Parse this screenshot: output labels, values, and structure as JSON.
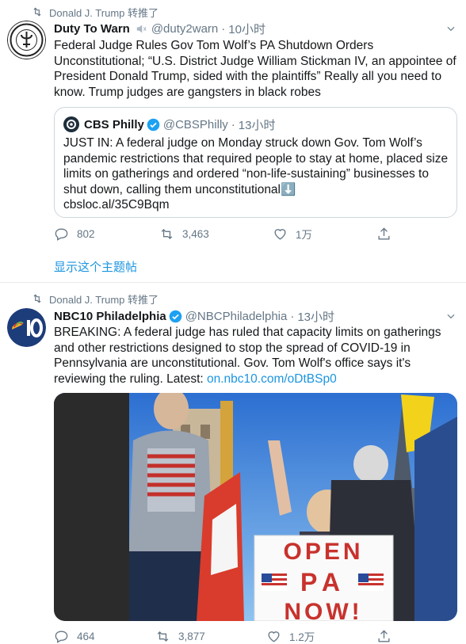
{
  "tweets": [
    {
      "retweeted_by": "Donald J. Trump 转推了",
      "author": {
        "name": "Duty To Warn",
        "handle": "@duty2warn",
        "time": "10小时"
      },
      "text": "Federal Judge Rules Gov Tom Wolf’s PA Shutdown Orders Unconstitutional; “U.S. District Judge William Stickman IV, an appointee of President Donald Trump, sided with the plaintiffs” Really all you need to know. Trump judges are gangsters in black robes",
      "quote": {
        "author": {
          "name": "CBS Philly",
          "handle": "@CBSPhilly",
          "time": "13小时"
        },
        "text": "JUST IN: A federal judge on Monday struck down Gov. Tom Wolf’s pandemic restrictions that required people to stay at home, placed size limits on gatherings and ordered “non-life-sustaining” businesses to shut down, calling them unconstitutional",
        "emoji": "⬇️",
        "link": "cbsloc.al/35C9Bqm"
      },
      "stats": {
        "replies": "802",
        "retweets": "3,463",
        "likes": "1万"
      },
      "show_thread": "显示这个主题帖"
    },
    {
      "retweeted_by": "Donald J. Trump 转推了",
      "author": {
        "name": "NBC10 Philadelphia",
        "handle": "@NBCPhiladelphia",
        "time": "13小时"
      },
      "text": "BREAKING: A federal judge has ruled that capacity limits on gatherings and other restrictions designed to stop the spread of COVID-19 in Pennsylvania are unconstitutional. Gov. Tom Wolf's office says it's reviewing the ruling. Latest: ",
      "link": "on.nbc10.com/oDtBSp0",
      "photo": {
        "sign_text": "OPEN PA NOW!"
      },
      "stats": {
        "replies": "464",
        "retweets": "3,877",
        "likes": "1.2万"
      }
    }
  ],
  "colors": {
    "accent": "#1b95e0",
    "muted": "#657786",
    "verified": "#1da1f2",
    "text": "#14171a"
  }
}
